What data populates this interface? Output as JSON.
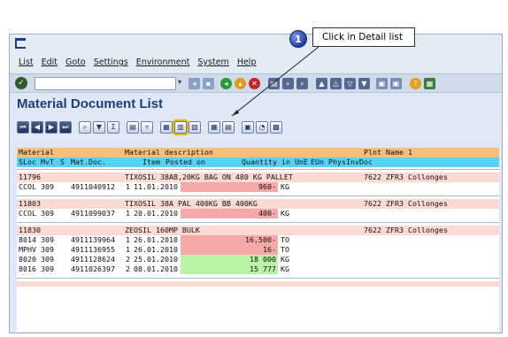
{
  "menu": [
    "List",
    "Edit",
    "Goto",
    "Settings",
    "Environment",
    "System",
    "Help"
  ],
  "callout": {
    "number": "1",
    "text": "Click in Detail list"
  },
  "title": "Material Document List",
  "list": {
    "header1": {
      "material": "Material",
      "description": "Material description",
      "plant": "Plnt Name 1"
    },
    "header2": {
      "sloc": "SLoc",
      "mvt": "MvT",
      "s": "S",
      "matdoc": "Mat.Doc.",
      "item": "Item",
      "posted": "Posted on",
      "qty": "Quantity in UnE",
      "eun": "EUn",
      "phys": "PhysInvDoc"
    },
    "materials": [
      {
        "number": "11796",
        "description": "TIXOSIL 38AB,20KG BAG ON 480 KG PALLET",
        "plant": "7622 ZFR3 Collonges",
        "items": [
          {
            "sloc": "CCOL",
            "mvt": "309",
            "doc": "4911040912",
            "item": "1",
            "date": "11.01.2010",
            "qty": "960-",
            "unit": "KG",
            "sign": "neg"
          }
        ]
      },
      {
        "number": "11803",
        "description": "TIXOSIL 38A PAL 400KG BB 400KG",
        "plant": "7622 ZFR3 Collonges",
        "items": [
          {
            "sloc": "CCOL",
            "mvt": "309",
            "doc": "4911099037",
            "item": "1",
            "date": "20.01.2010",
            "qty": "400-",
            "unit": "KG",
            "sign": "neg"
          }
        ]
      },
      {
        "number": "11830",
        "description": "ZEOSIL 160MP BULK",
        "plant": "7622 ZFR3 Collonges",
        "items": [
          {
            "sloc": "8014",
            "mvt": "309",
            "doc": "4911139964",
            "item": "1",
            "date": "26.01.2010",
            "qty": "16,500-",
            "unit": "TO",
            "sign": "neg"
          },
          {
            "sloc": "MPHV",
            "mvt": "309",
            "doc": "4911136955",
            "item": "1",
            "date": "26.01.2010",
            "qty": "16-",
            "unit": "TO",
            "sign": "neg"
          },
          {
            "sloc": "8020",
            "mvt": "309",
            "doc": "4911128624",
            "item": "2",
            "date": "25.01.2010",
            "qty": "18 000",
            "unit": "KG",
            "sign": "pos"
          },
          {
            "sloc": "8016",
            "mvt": "309",
            "doc": "4911026397",
            "item": "2",
            "date": "08.01.2010",
            "qty": "15 777",
            "unit": "KG",
            "sign": "pos"
          }
        ]
      }
    ]
  }
}
